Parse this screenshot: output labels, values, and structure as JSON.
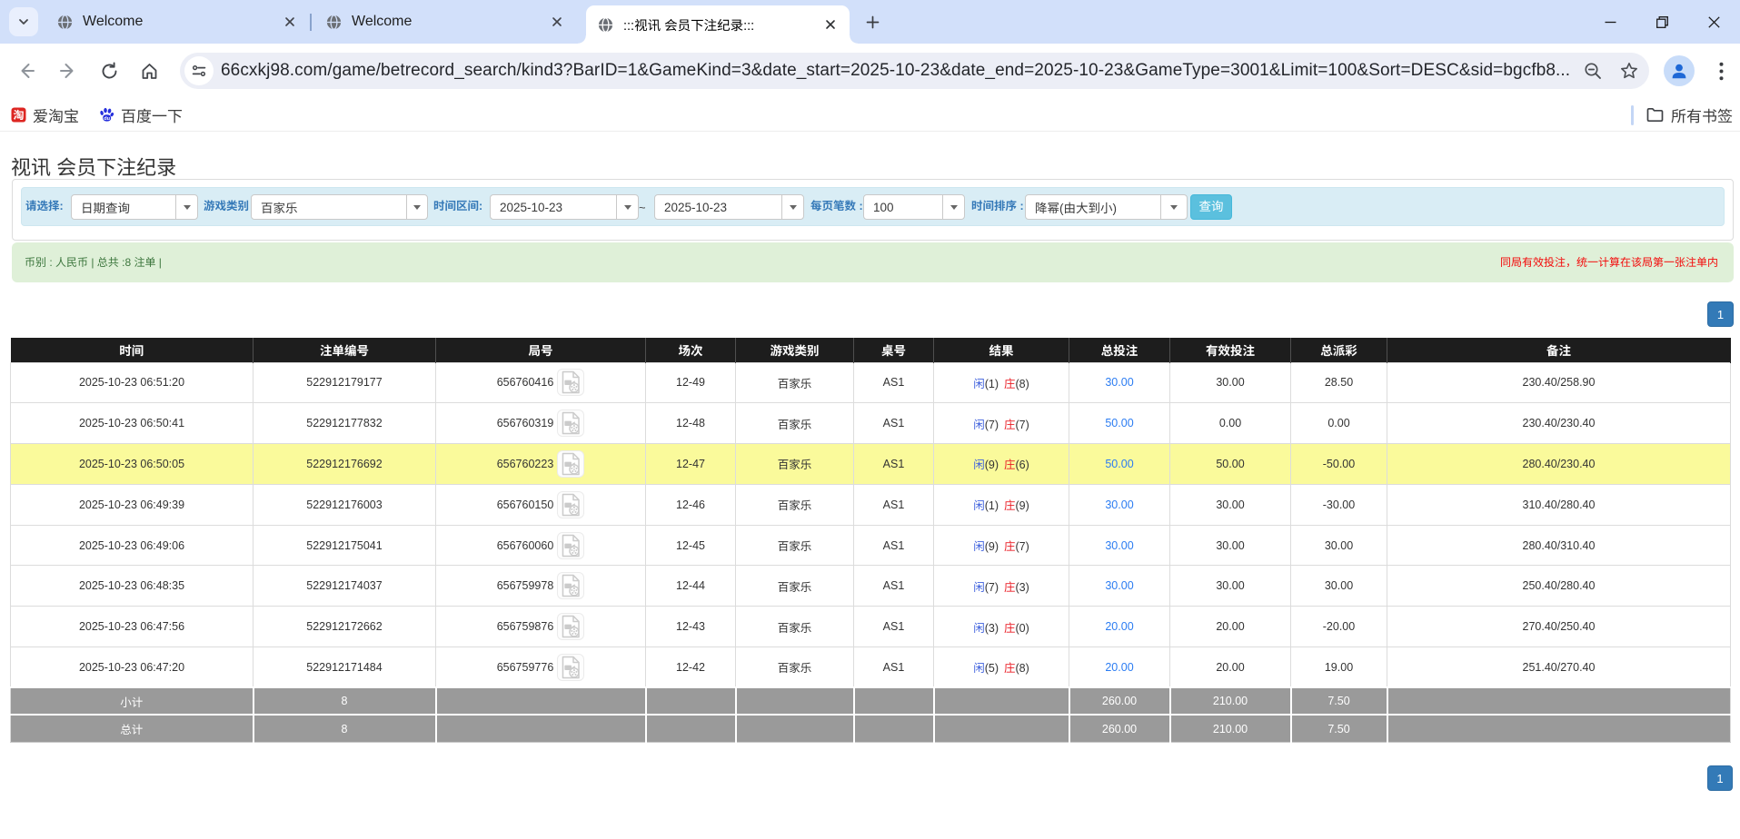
{
  "browser": {
    "tabs": [
      {
        "title": "Welcome"
      },
      {
        "title": "Welcome"
      },
      {
        "title": ":::视讯 会员下注纪录:::"
      }
    ],
    "url": "66cxkj98.com/game/betrecord_search/kind3?BarID=1&GameKind=3&date_start=2025-10-23&date_end=2025-10-23&GameType=3001&Limit=100&Sort=DESC&sid=bgcfb8...",
    "bookmarks": {
      "taobao_label": "爱淘宝",
      "taobao_glyph": "淘",
      "baidu_label": "百度一下",
      "baidu_glyph": "du",
      "all_bookmarks_label": "所有书签"
    }
  },
  "page": {
    "title": "视讯 会员下注纪录",
    "filters": {
      "select_label": "请选择:",
      "select_value": "日期查询",
      "game_label": "游戏类别",
      "game_value": "百家乐",
      "range_label": "时间区间:",
      "date_start": "2025-10-23",
      "tilde": "~",
      "date_end": "2025-10-23",
      "per_page_label": "每页笔数 :",
      "per_page_value": "100",
      "sort_label": "时间排序 :",
      "sort_value": "降幂(由大到小)",
      "search_button": "查询"
    },
    "summary": {
      "left": "币别 : 人民币 | 总共 :8 注单 |",
      "right": "同局有效投注，统一计算在该局第一张注单内"
    },
    "pagination": {
      "page": "1"
    },
    "table": {
      "headers": [
        "时间",
        "注单编号",
        "局号",
        "场次",
        "游戏类别",
        "桌号",
        "结果",
        "总投注",
        "有效投注",
        "总派彩",
        "备注"
      ],
      "rows": [
        {
          "time": "2025-10-23 06:51:20",
          "bet_id": "522912179177",
          "round": "656760416",
          "session": "12-49",
          "game": "百家乐",
          "table": "AS1",
          "player": "闲",
          "player_pts": "(1)",
          "banker": "庄",
          "banker_pts": "(8)",
          "total_bet": "30.00",
          "valid_bet": "30.00",
          "payout": "28.50",
          "remark": "230.40/258.90"
        },
        {
          "time": "2025-10-23 06:50:41",
          "bet_id": "522912177832",
          "round": "656760319",
          "session": "12-48",
          "game": "百家乐",
          "table": "AS1",
          "player": "闲",
          "player_pts": "(7)",
          "banker": "庄",
          "banker_pts": "(7)",
          "total_bet": "50.00",
          "valid_bet": "0.00",
          "payout": "0.00",
          "remark": "230.40/230.40"
        },
        {
          "time": "2025-10-23 06:50:05",
          "bet_id": "522912176692",
          "round": "656760223",
          "session": "12-47",
          "game": "百家乐",
          "table": "AS1",
          "player": "闲",
          "player_pts": "(9)",
          "banker": "庄",
          "banker_pts": "(6)",
          "total_bet": "50.00",
          "valid_bet": "50.00",
          "payout": "-50.00",
          "remark": "280.40/230.40"
        },
        {
          "time": "2025-10-23 06:49:39",
          "bet_id": "522912176003",
          "round": "656760150",
          "session": "12-46",
          "game": "百家乐",
          "table": "AS1",
          "player": "闲",
          "player_pts": "(1)",
          "banker": "庄",
          "banker_pts": "(9)",
          "total_bet": "30.00",
          "valid_bet": "30.00",
          "payout": "-30.00",
          "remark": "310.40/280.40"
        },
        {
          "time": "2025-10-23 06:49:06",
          "bet_id": "522912175041",
          "round": "656760060",
          "session": "12-45",
          "game": "百家乐",
          "table": "AS1",
          "player": "闲",
          "player_pts": "(9)",
          "banker": "庄",
          "banker_pts": "(7)",
          "total_bet": "30.00",
          "valid_bet": "30.00",
          "payout": "30.00",
          "remark": "280.40/310.40"
        },
        {
          "time": "2025-10-23 06:48:35",
          "bet_id": "522912174037",
          "round": "656759978",
          "session": "12-44",
          "game": "百家乐",
          "table": "AS1",
          "player": "闲",
          "player_pts": "(7)",
          "banker": "庄",
          "banker_pts": "(3)",
          "total_bet": "30.00",
          "valid_bet": "30.00",
          "payout": "30.00",
          "remark": "250.40/280.40"
        },
        {
          "time": "2025-10-23 06:47:56",
          "bet_id": "522912172662",
          "round": "656759876",
          "session": "12-43",
          "game": "百家乐",
          "table": "AS1",
          "player": "闲",
          "player_pts": "(3)",
          "banker": "庄",
          "banker_pts": "(0)",
          "total_bet": "20.00",
          "valid_bet": "20.00",
          "payout": "-20.00",
          "remark": "270.40/250.40"
        },
        {
          "time": "2025-10-23 06:47:20",
          "bet_id": "522912171484",
          "round": "656759776",
          "session": "12-42",
          "game": "百家乐",
          "table": "AS1",
          "player": "闲",
          "player_pts": "(5)",
          "banker": "庄",
          "banker_pts": "(8)",
          "total_bet": "20.00",
          "valid_bet": "20.00",
          "payout": "19.00",
          "remark": "251.40/270.40"
        }
      ],
      "subtotal": {
        "label": "小计",
        "count": "8",
        "total_bet": "260.00",
        "valid_bet": "210.00",
        "payout": "7.50"
      },
      "total": {
        "label": "总计",
        "count": "8",
        "total_bet": "260.00",
        "valid_bet": "210.00",
        "payout": "7.50"
      }
    }
  }
}
